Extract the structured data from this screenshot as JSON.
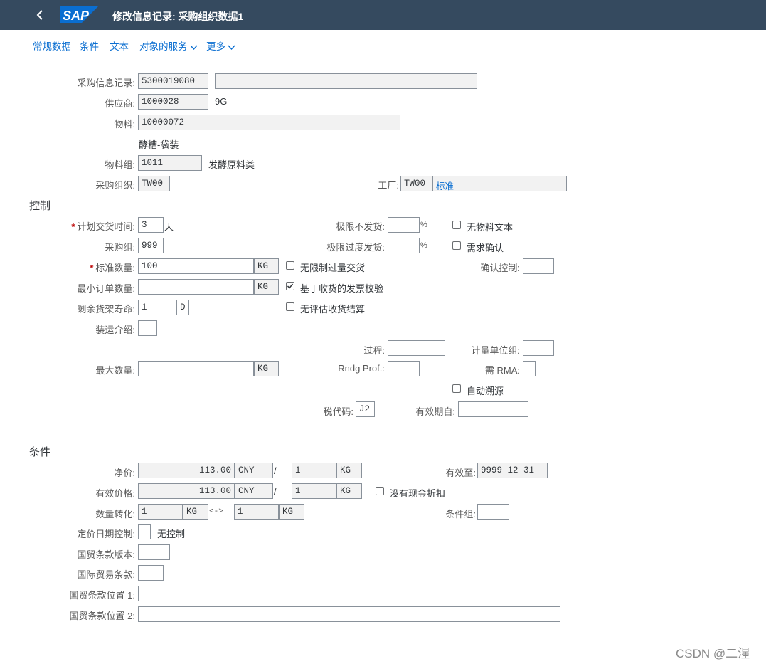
{
  "shell": {
    "title": "修改信息记录: 采购组织数据1",
    "logo_text": "SAP",
    "brand_color": "#0a6ed1",
    "shell_color": "#354a5f"
  },
  "tabs": [
    {
      "label": "常规数据"
    },
    {
      "label": "条件"
    },
    {
      "label": "文本"
    },
    {
      "label": "对象的服务"
    },
    {
      "label": "更多"
    }
  ],
  "header": {
    "info_record": {
      "label": "采购信息记录:",
      "value": "5300019080",
      "desc": ""
    },
    "vendor": {
      "label": "供应商:",
      "value": "1000028",
      "desc": "9G"
    },
    "material": {
      "label": "物料:",
      "value": "10000072",
      "desc": "酵糟-袋装"
    },
    "material_group": {
      "label": "物料组:",
      "value": "1011",
      "desc": "发酵原料类"
    },
    "purch_org": {
      "label": "采购组织:",
      "value": "TW00"
    },
    "plant": {
      "label": "工厂:",
      "value": "TW00",
      "desc": "标准"
    }
  },
  "control": {
    "title": "控制",
    "planned_delivery": {
      "label": "计划交货时间:",
      "value": "3",
      "unit": "天",
      "required": "*"
    },
    "purch_group": {
      "label": "采购组:",
      "value": "999"
    },
    "std_qty": {
      "label": "标准数量:",
      "value": "100",
      "unit": "KG",
      "required": "*"
    },
    "min_order": {
      "label": "最小订单数量:",
      "value": "",
      "unit": "KG"
    },
    "shelf_life": {
      "label": "剩余货架寿命:",
      "value": "1",
      "unit": "D"
    },
    "shipping": {
      "label": "装运介绍:",
      "value": ""
    },
    "max_qty": {
      "label": "最大数量:",
      "value": "",
      "unit": "KG"
    },
    "underdelivery": {
      "label": "极限不发货:",
      "value": "",
      "unit": "%"
    },
    "overdelivery": {
      "label": "极限过度发货:",
      "value": "",
      "unit": "%"
    },
    "unlimited_over": {
      "label": "无限制过量交货",
      "checked": false
    },
    "gr_based_iv": {
      "label": "基于收货的发票校验",
      "checked": true
    },
    "no_eval_gr": {
      "label": "无评估收货结算",
      "checked": false
    },
    "procedure": {
      "label": "过程:",
      "value": ""
    },
    "rndg_prof": {
      "label": "Rndg Prof.:",
      "value": ""
    },
    "tax_code": {
      "label": "税代码:",
      "value": "J2"
    },
    "valid_from": {
      "label": "有效期自:",
      "value": ""
    },
    "no_mat_text": {
      "label": "无物料文本",
      "checked": false
    },
    "ack_req": {
      "label": "需求确认",
      "checked": false
    },
    "conf_control": {
      "label": "确认控制:",
      "value": ""
    },
    "uom_group": {
      "label": "计量单位组:",
      "value": ""
    },
    "rma_req": {
      "label": "需 RMA:",
      "value": ""
    },
    "auto_source": {
      "label": "自动溯源",
      "checked": false
    }
  },
  "conditions": {
    "title": "条件",
    "net_price": {
      "label": "净价:",
      "value": "113.00",
      "currency": "CNY",
      "sep": "/",
      "per": "1",
      "unit": "KG"
    },
    "eff_price": {
      "label": "有效价格:",
      "value": "113.00",
      "currency": "CNY",
      "sep": "/",
      "per": "1",
      "unit": "KG"
    },
    "qty_conv": {
      "label": "数量转化:",
      "from": "1",
      "from_unit": "KG",
      "arrow": "<->",
      "to": "1",
      "to_unit": "KG"
    },
    "pricing_date": {
      "label": "定价日期控制:",
      "value": "",
      "desc": "无控制"
    },
    "incoterms_version": {
      "label": "国贸条款版本:",
      "value": ""
    },
    "incoterms": {
      "label": "国际贸易条款:",
      "value": ""
    },
    "incoterms_loc1": {
      "label": "国贸条款位置 1:",
      "value": ""
    },
    "incoterms_loc2": {
      "label": "国贸条款位置 2:",
      "value": ""
    },
    "valid_to": {
      "label": "有效至:",
      "value": "9999-12-31"
    },
    "no_cash_discount": {
      "label": "没有现金折扣",
      "checked": false
    },
    "cond_group": {
      "label": "条件组:",
      "value": ""
    }
  },
  "watermark": "CSDN @二湦"
}
